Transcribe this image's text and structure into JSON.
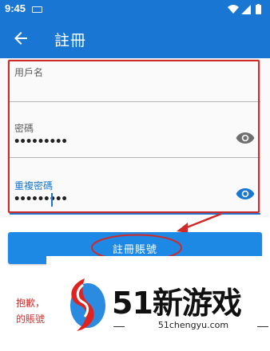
{
  "status_bar": {
    "time": "9:45",
    "icons": [
      "keyboard-icon",
      "wifi-icon",
      "signal-icon",
      "battery-icon"
    ]
  },
  "app_bar": {
    "back_icon": "arrow-left-icon",
    "title": "註冊",
    "color": "#1976d2"
  },
  "form": {
    "username": {
      "label": "用戶名",
      "value": ""
    },
    "password": {
      "label": "密碼",
      "value": "•••••••••",
      "toggle_icon": "eye-icon"
    },
    "confirm_password": {
      "label": "重複密碼",
      "value": "•••••••••",
      "toggle_icon": "eye-icon",
      "focused": true
    }
  },
  "register_button": {
    "label": "註冊賬號",
    "color": "#1e88e5"
  },
  "error": {
    "line1": "抱歉，",
    "line2": "的賬號"
  },
  "watermark": {
    "logo": "51-logo",
    "text": "51新游戏",
    "url": "51chengyu.com"
  },
  "colors": {
    "accent": "#1976d2",
    "annotation": "#cf2a2a",
    "error": "#d32f2f"
  }
}
